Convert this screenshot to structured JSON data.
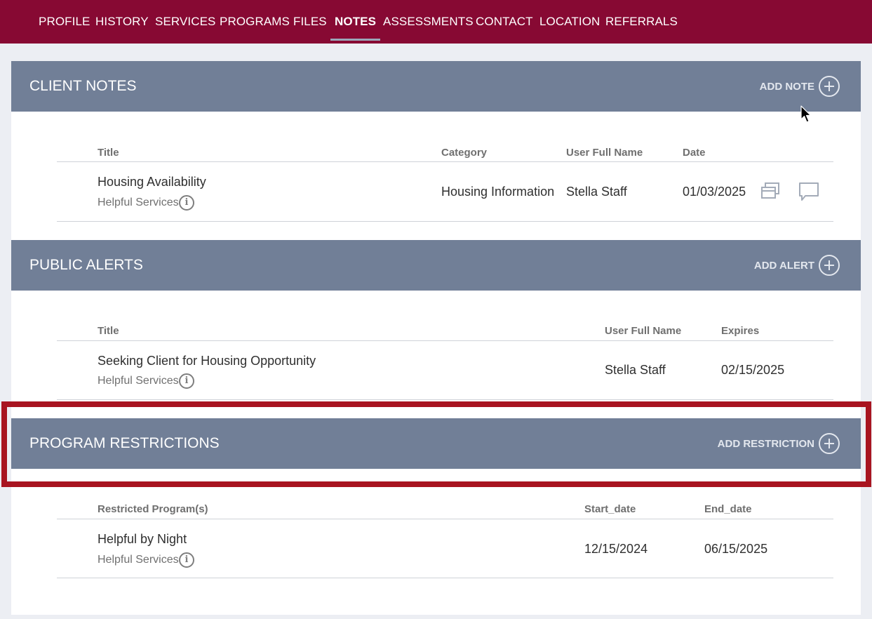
{
  "nav": {
    "items": [
      {
        "label": "PROFILE"
      },
      {
        "label": "HISTORY"
      },
      {
        "label": "SERVICES"
      },
      {
        "label": "PROGRAMS"
      },
      {
        "label": "FILES"
      },
      {
        "label": "NOTES",
        "active": true
      },
      {
        "label": "ASSESSMENTS"
      },
      {
        "label": "CONTACT"
      },
      {
        "label": "LOCATION"
      },
      {
        "label": "REFERRALS"
      }
    ]
  },
  "client_notes": {
    "title": "CLIENT NOTES",
    "add_label": "ADD NOTE",
    "columns": {
      "title": "Title",
      "category": "Category",
      "user": "User Full Name",
      "date": "Date"
    },
    "rows": [
      {
        "title": "Housing Availability",
        "agency": "Helpful Services",
        "category": "Housing Information",
        "user": "Stella Staff",
        "date": "01/03/2025",
        "icons": [
          "copy-icon",
          "comment-icon"
        ]
      }
    ]
  },
  "public_alerts": {
    "title": "PUBLIC ALERTS",
    "add_label": "ADD ALERT",
    "columns": {
      "title": "Title",
      "user": "User Full Name",
      "expires": "Expires"
    },
    "rows": [
      {
        "title": "Seeking Client for Housing Opportunity",
        "agency": "Helpful Services",
        "user": "Stella Staff",
        "expires": "02/15/2025"
      }
    ]
  },
  "program_restrictions": {
    "title": "PROGRAM RESTRICTIONS",
    "add_label": "ADD RESTRICTION",
    "columns": {
      "programs": "Restricted Program(s)",
      "start": "Start_date",
      "end": "End_date"
    },
    "rows": [
      {
        "program": "Helpful by Night",
        "agency": "Helpful Services",
        "start": "12/15/2024",
        "end": "06/15/2025"
      }
    ]
  },
  "info_glyph": "i",
  "colors": {
    "nav_bg": "#870933",
    "section_header": "#717f97",
    "highlight": "#a81420",
    "page_bg": "#eceef3"
  }
}
